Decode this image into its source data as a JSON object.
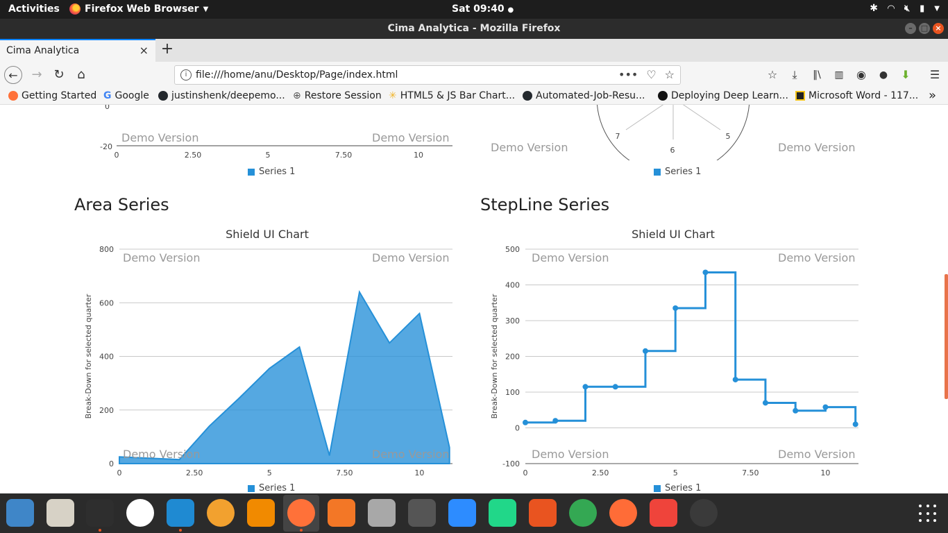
{
  "gnome_bar": {
    "activities": "Activities",
    "app_menu": "Firefox Web Browser",
    "clock": "Sat 09:40"
  },
  "window": {
    "title": "Cima Analytica - Mozilla Firefox"
  },
  "tab": {
    "title": "Cima Analytica",
    "close": "×",
    "new_tab": "+"
  },
  "nav": {
    "url": "file:///home/anu/Desktop/Page/index.html",
    "url_tools": "•••"
  },
  "bookmarks": [
    {
      "label": "Getting Started",
      "color": "#ff7139"
    },
    {
      "label": "Google",
      "color": "#4285f4"
    },
    {
      "label": "justinshenk/deepemo...",
      "color": "#24292e"
    },
    {
      "label": "Restore Session",
      "color": "#555555"
    },
    {
      "label": "HTML5 & JS Bar Chart...",
      "color": "#f0b429"
    },
    {
      "label": "Automated-Job-Resu...",
      "color": "#24292e"
    },
    {
      "label": "Deploying Deep Learn...",
      "color": "#111111"
    },
    {
      "label": "Microsoft Word - 117...",
      "color": "#222222"
    }
  ],
  "bookmarks_overflow": "»",
  "top_partial": {
    "left": {
      "y_tick_top": "0",
      "y_tick_bottom": "-20",
      "x_ticks": [
        "0",
        "2.50",
        "5",
        "7.50",
        "10"
      ],
      "legend": "Series 1",
      "watermark_left": "Demo Version",
      "watermark_right": "Demo Version"
    },
    "right": {
      "polar_labels": [
        "7",
        "6",
        "5"
      ],
      "legend": "Series 1",
      "watermark_left": "Demo Version",
      "watermark_right": "Demo Version"
    }
  },
  "area_section": {
    "heading": "Area Series",
    "chart_title": "Shield UI Chart",
    "ylabel": "Break-Down for selected quarter",
    "legend": "Series 1",
    "watermark": "Demo Version"
  },
  "stepline_section": {
    "heading": "StepLine Series",
    "chart_title": "Shield UI Chart",
    "ylabel": "Break-Down for selected quarter",
    "legend": "Series 1",
    "watermark": "Demo Version"
  },
  "chart_data": [
    {
      "type": "area",
      "title": "Shield UI Chart",
      "ylabel": "Break-Down for selected quarter",
      "xlabel": "",
      "x": [
        0,
        1,
        2,
        3,
        4,
        5,
        6,
        7,
        8,
        9,
        10,
        11
      ],
      "x_ticks": [
        "0",
        "2.50",
        "5",
        "7.50",
        "10"
      ],
      "y_ticks": [
        "0",
        "200",
        "400",
        "600",
        "800"
      ],
      "xlim": [
        0,
        11.1
      ],
      "ylim": [
        0,
        800
      ],
      "series": [
        {
          "name": "Series 1",
          "values": [
            25,
            20,
            15,
            140,
            245,
            355,
            435,
            30,
            640,
            450,
            560,
            60
          ]
        }
      ],
      "color": "#2590d8"
    },
    {
      "type": "line",
      "step": true,
      "title": "Shield UI Chart",
      "ylabel": "Break-Down for selected quarter",
      "xlabel": "",
      "x": [
        0,
        1,
        2,
        3,
        4,
        5,
        6,
        7,
        8,
        9,
        10,
        11
      ],
      "x_ticks": [
        "0",
        "2.50",
        "5",
        "7.50",
        "10"
      ],
      "y_ticks": [
        "-100",
        "0",
        "100",
        "200",
        "300",
        "400",
        "500"
      ],
      "xlim": [
        0,
        11.1
      ],
      "ylim": [
        -100,
        500
      ],
      "series": [
        {
          "name": "Series 1",
          "values": [
            15,
            20,
            115,
            115,
            215,
            335,
            435,
            135,
            70,
            48,
            58,
            10
          ]
        }
      ],
      "color": "#2590d8"
    }
  ],
  "dock": {
    "apps": [
      {
        "name": "image-viewer-icon",
        "color": "#3f86c8"
      },
      {
        "name": "text-editor-icon",
        "color": "#d7d2c6"
      },
      {
        "name": "terminal-icon",
        "color": "#2e2e2e"
      },
      {
        "name": "slack-icon",
        "color": "#ffffff"
      },
      {
        "name": "vscode-icon",
        "color": "#1f8ad2"
      },
      {
        "name": "audacity-icon",
        "color": "#f2a12f"
      },
      {
        "name": "vlc-icon",
        "color": "#f18a00"
      },
      {
        "name": "firefox-icon",
        "color": "#ff7139"
      },
      {
        "name": "jupyter-icon",
        "color": "#f37726"
      },
      {
        "name": "files-icon",
        "color": "#a8a8a8"
      },
      {
        "name": "calculator-icon",
        "color": "#555555"
      },
      {
        "name": "zoom-icon",
        "color": "#2d8cff"
      },
      {
        "name": "pycharm-icon",
        "color": "#21d789"
      },
      {
        "name": "software-center-icon",
        "color": "#e95420"
      },
      {
        "name": "chrome-icon",
        "color": "#34a853"
      },
      {
        "name": "postman-icon",
        "color": "#ff6c37"
      },
      {
        "name": "anydesk-icon",
        "color": "#ef443b"
      },
      {
        "name": "webcam-icon",
        "color": "#3a3a3a"
      }
    ]
  }
}
